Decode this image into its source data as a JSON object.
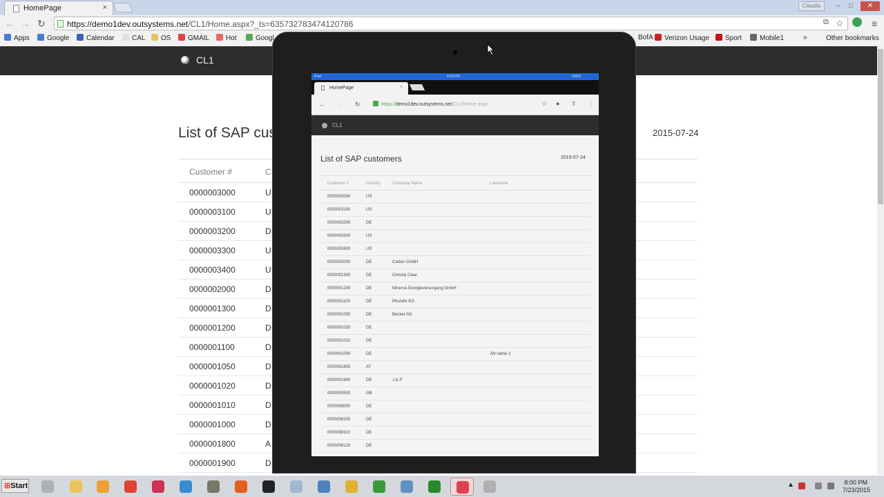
{
  "browser": {
    "tab_title": "HomePage",
    "tab_close": "×",
    "user_badge": "Claudio",
    "url_host": "https://demo1dev.outsystems.net",
    "url_path": "/CL1/Home.aspx?_ts=635732783474120786",
    "bookmarks": [
      {
        "label": "Apps",
        "color": "#4a7bd1"
      },
      {
        "label": "Google",
        "color": "#4a7bd1"
      },
      {
        "label": "Calendar",
        "color": "#3a62c0"
      },
      {
        "label": "CAL",
        "color": "#e0e0e0"
      },
      {
        "label": "OS",
        "color": "#e8c060"
      },
      {
        "label": "GMAIL",
        "color": "#d44"
      },
      {
        "label": "Hot",
        "color": "#e66"
      },
      {
        "label": "Googl",
        "color": "#5a5"
      },
      {
        "label": "BofA",
        "color": "#c22"
      },
      {
        "label": "Verizon Usage",
        "color": "#c22"
      },
      {
        "label": "Sport",
        "color": "#c11"
      },
      {
        "label": "Mobile1",
        "color": "#666"
      }
    ],
    "overflow": "»",
    "other_bookmarks": "Other bookmarks"
  },
  "site": {
    "title": "CL1",
    "heading": "List of SAP cus",
    "date": "2015-07-24",
    "headers": [
      "Customer #",
      "C"
    ],
    "rows": [
      [
        "0000003000",
        "U"
      ],
      [
        "0000003100",
        "U"
      ],
      [
        "0000003200",
        "D"
      ],
      [
        "0000003300",
        "U"
      ],
      [
        "0000003400",
        "U"
      ],
      [
        "0000002000",
        "D"
      ],
      [
        "0000001300",
        "D"
      ],
      [
        "0000001200",
        "D"
      ],
      [
        "0000001100",
        "D"
      ],
      [
        "0000001050",
        "D"
      ],
      [
        "0000001020",
        "D"
      ],
      [
        "0000001010",
        "D"
      ],
      [
        "0000001000",
        "D"
      ],
      [
        "0000001800",
        "A"
      ],
      [
        "0000001900",
        "D"
      ]
    ]
  },
  "ipad": {
    "status_left": "iPad",
    "status_time": "8:00 PM",
    "status_battery": "100%",
    "tab_title": "HomePage",
    "tab_close": "×",
    "url_scheme": "https://",
    "url_host": "demo1dev.outsystems.net",
    "url_path": "/CL1/Home.aspx",
    "site_title": "CL1",
    "heading": "List of SAP customers",
    "date": "2015-07-24",
    "headers": [
      "Customer #",
      "Country",
      "Company Name",
      "Lastname"
    ],
    "rows": [
      [
        "0000003000",
        "US",
        "",
        ""
      ],
      [
        "0000003100",
        "US",
        "",
        ""
      ],
      [
        "0000003200",
        "DE",
        "",
        ""
      ],
      [
        "0000003300",
        "US",
        "",
        ""
      ],
      [
        "0000003400",
        "US",
        "",
        ""
      ],
      [
        "0000002000",
        "DE",
        "Carbor GmbH",
        ""
      ],
      [
        "0000001300",
        "DE",
        "Christal Clear",
        ""
      ],
      [
        "0000001200",
        "DE",
        "Minerva Energieversorgung GmbH",
        ""
      ],
      [
        "0000001100",
        "DE",
        "Phundix KG",
        ""
      ],
      [
        "0000001050",
        "DE",
        "Becker AG",
        ""
      ],
      [
        "0000001020",
        "DE",
        "",
        ""
      ],
      [
        "0000001010",
        "DE",
        "",
        ""
      ],
      [
        "0000001000",
        "DE",
        "",
        "JW name 2"
      ],
      [
        "0000001800",
        "AT",
        "",
        ""
      ],
      [
        "0000001900",
        "DE",
        "J & P",
        ""
      ],
      [
        "0000003500",
        "GB",
        "",
        ""
      ],
      [
        "0000008000",
        "DE",
        "",
        ""
      ],
      [
        "0000008100",
        "DE",
        "",
        ""
      ],
      [
        "0000008110",
        "DE",
        "",
        ""
      ],
      [
        "0000008120",
        "DE",
        "",
        ""
      ]
    ]
  },
  "taskbar": {
    "start_label": "Start",
    "apps": [
      {
        "name": "app-disc",
        "color": "#b0b0b0"
      },
      {
        "name": "app-explorer",
        "color": "#e8c45a"
      },
      {
        "name": "app-media",
        "color": "#f0a030"
      },
      {
        "name": "app-chrome",
        "color": "#dd4433"
      },
      {
        "name": "app-snip",
        "color": "#cc3355"
      },
      {
        "name": "app-ie",
        "color": "#3a8ad0"
      },
      {
        "name": "app-gimp",
        "color": "#777766"
      },
      {
        "name": "app-firefox",
        "color": "#e06020"
      },
      {
        "name": "app-cmd",
        "color": "#222222"
      },
      {
        "name": "app-calc",
        "color": "#a0b8d0"
      },
      {
        "name": "app-metro",
        "color": "#5080c0"
      },
      {
        "name": "app-folder",
        "color": "#e0b030"
      },
      {
        "name": "app-green-c",
        "color": "#3a9a3a"
      },
      {
        "name": "app-screen",
        "color": "#6090c0"
      },
      {
        "name": "app-green-c2",
        "color": "#2a8a2a"
      },
      {
        "name": "app-paint",
        "color": "#e04050"
      },
      {
        "name": "app-disc2",
        "color": "#b0b0b0"
      }
    ],
    "time": "8:00 PM",
    "date": "7/23/2015"
  }
}
